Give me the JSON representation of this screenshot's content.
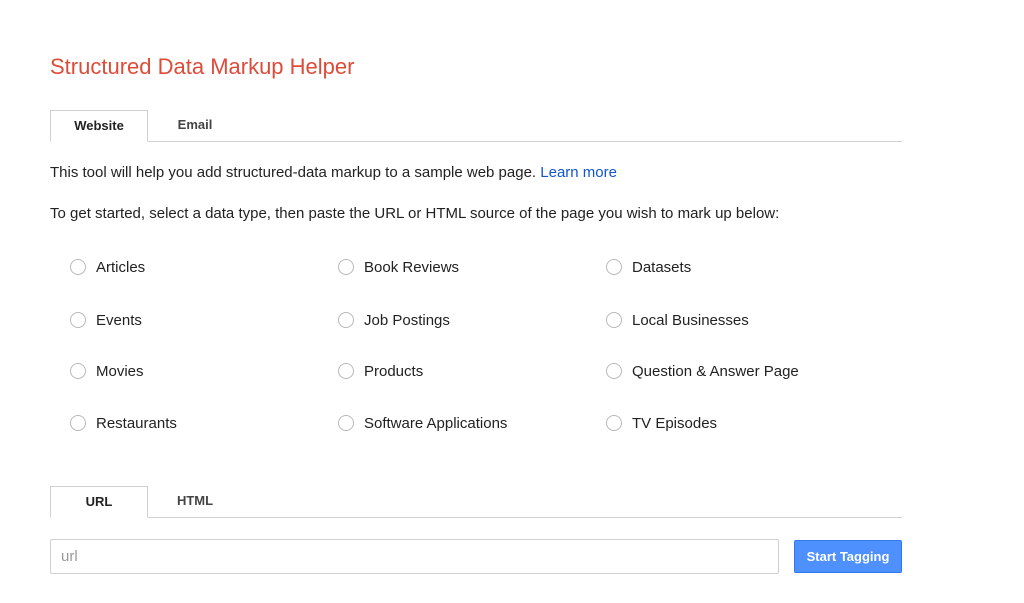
{
  "page_title": "Structured Data Markup Helper",
  "source_tabs": {
    "website": "Website",
    "email": "Email"
  },
  "intro": {
    "text": "This tool will help you add structured-data markup to a sample web page.",
    "link_label": "Learn more"
  },
  "instructions": "To get started, select a data type, then paste the URL or HTML source of the page you wish to mark up below:",
  "data_types": [
    "Articles",
    "Book Reviews",
    "Datasets",
    "Events",
    "Job Postings",
    "Local Businesses",
    "Movies",
    "Products",
    "Question & Answer Page",
    "Restaurants",
    "Software Applications",
    "TV Episodes"
  ],
  "input_tabs": {
    "url": "URL",
    "html": "HTML"
  },
  "url_field": {
    "placeholder": "url",
    "value": ""
  },
  "start_button_label": "Start Tagging",
  "colors": {
    "title": "#dd4b39",
    "link": "#1155cc",
    "primary_button": "#4d90fe"
  }
}
